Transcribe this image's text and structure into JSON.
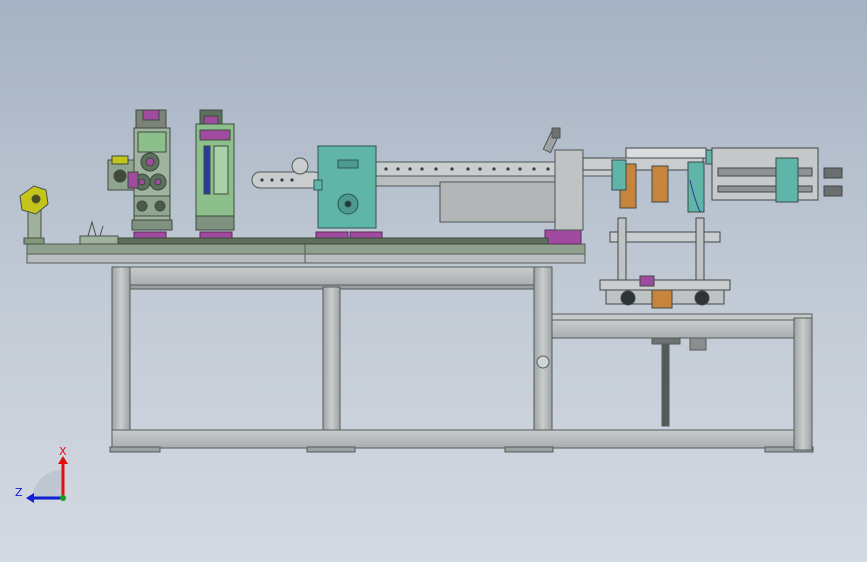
{
  "triad": {
    "x_label": "X",
    "z_label": "Z"
  },
  "colors": {
    "background_top": "#a6b2c3",
    "background_bottom": "#d4dae2",
    "frame": "#b4b8b8",
    "frame_edge": "#555b5b",
    "base_plate": "#8fa08c",
    "green_part": "#8cbf8c",
    "teal_part": "#5fb5a8",
    "magenta_part": "#a04aa0",
    "axis_x": "#e01010",
    "axis_z": "#1020d0",
    "axis_y": "#10a020"
  }
}
